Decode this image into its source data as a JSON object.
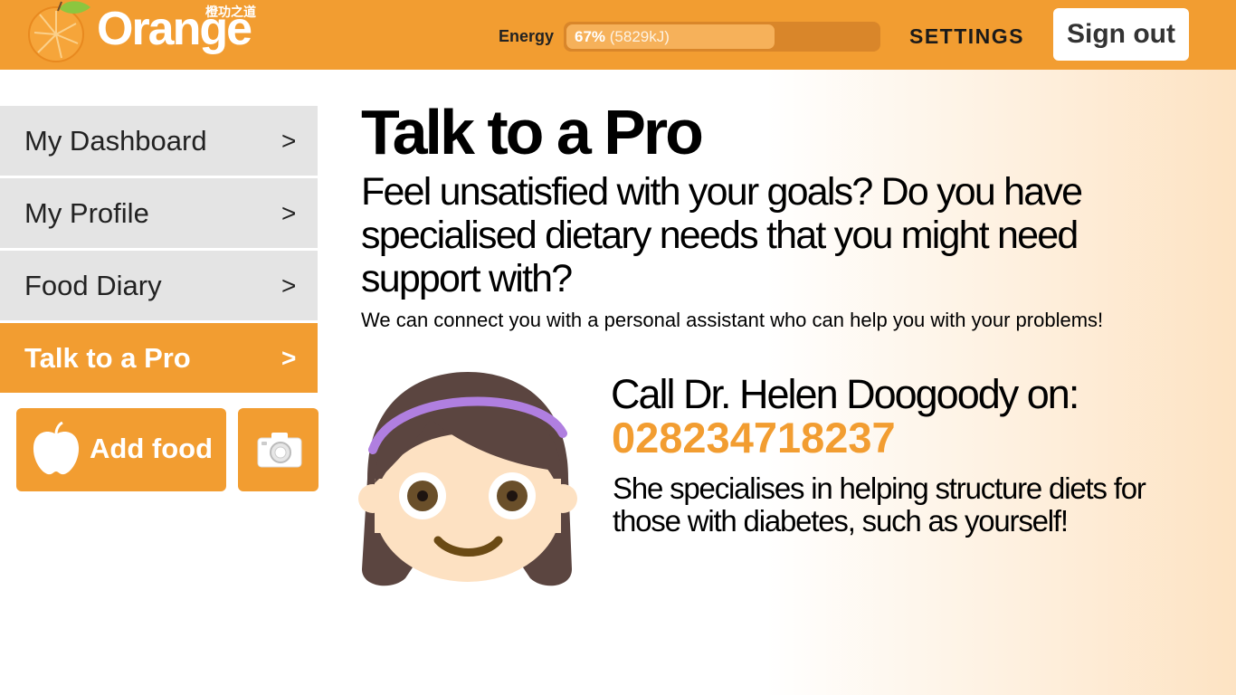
{
  "header": {
    "logo_text": "Orange",
    "logo_subtext": "橙功之道",
    "energy_label": "Energy",
    "energy_percent_text": "67%",
    "energy_kj_text": "(5829kJ)",
    "energy_level": 0.67,
    "settings_label": "SETTINGS",
    "signout_label": "Sign out"
  },
  "sidebar": {
    "items": [
      {
        "label": "My Dashboard",
        "chevron": ">",
        "active": false
      },
      {
        "label": "My Profile",
        "chevron": ">",
        "active": false
      },
      {
        "label": "Food Diary",
        "chevron": ">",
        "active": false
      },
      {
        "label": "Talk to a Pro",
        "chevron": ">",
        "active": true
      }
    ],
    "add_food_label": "Add food",
    "add_food_icon": "apple-icon",
    "camera_icon": "camera-icon"
  },
  "main": {
    "title": "Talk to a Pro",
    "intro": "Feel unsatisfied with your goals? Do you have specialised dietary needs that you might need support with?",
    "connect_text": "We can connect you with a personal assistant who can help you with your problems!",
    "call_text": "Call Dr. Helen Doogoody on:",
    "phone": "028234718237",
    "description": "She specialises in helping structure diets for those with diabetes, such as yourself!"
  },
  "colors": {
    "accent": "#f29d31",
    "nav_bg": "#e4e4e4",
    "gradient_end": "#fde3c3"
  }
}
